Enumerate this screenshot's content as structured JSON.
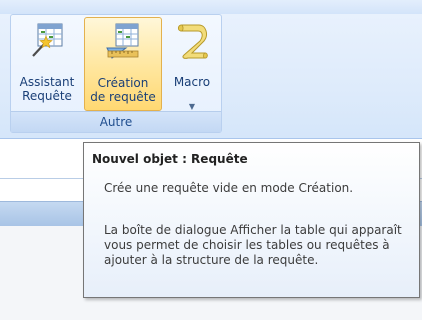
{
  "ribbon": {
    "group": {
      "label": "Autre",
      "buttons": [
        {
          "line1": "Assistant",
          "line2": "Requête",
          "icon": "query-wizard-icon"
        },
        {
          "line1": "Création",
          "line2": "de requête",
          "icon": "query-design-icon"
        },
        {
          "line1": "Macro",
          "line2": "",
          "icon": "macro-scroll-icon",
          "has_dropdown": true
        }
      ]
    }
  },
  "tooltip": {
    "title": "Nouvel objet : Requête",
    "paragraphs": [
      "Crée une requête vide en mode Création.",
      "La boîte de dialogue Afficher la table qui apparaît vous permet de choisir les tables ou requêtes à ajouter à la structure de la requête."
    ]
  },
  "colors": {
    "ribbon_bg": "#deebfb",
    "active_button": "#ffe9a7",
    "label_text": "#1a3f77"
  }
}
